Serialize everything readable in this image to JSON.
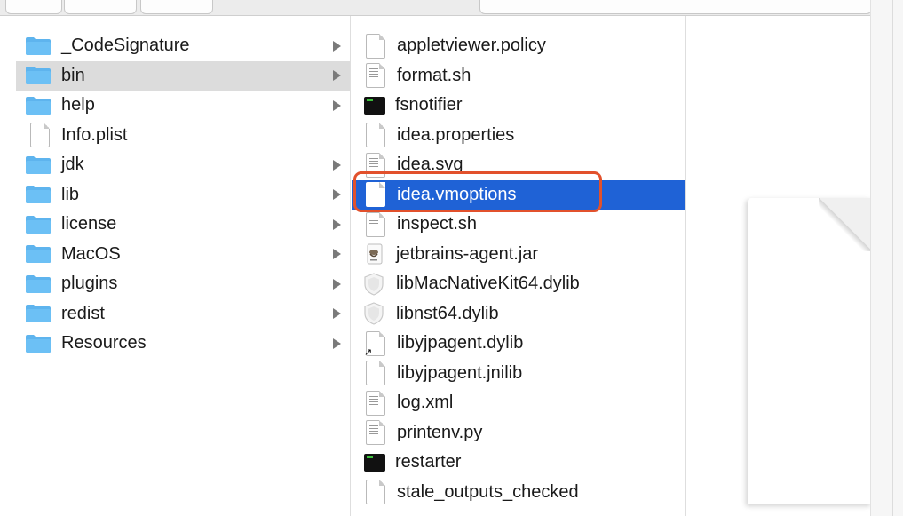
{
  "left_column": {
    "items": [
      {
        "label": "_CodeSignature",
        "kind": "folder",
        "expandable": true
      },
      {
        "label": "bin",
        "kind": "folder",
        "expandable": true,
        "selected": "gray"
      },
      {
        "label": "help",
        "kind": "folder",
        "expandable": true
      },
      {
        "label": "Info.plist",
        "kind": "document",
        "expandable": false
      },
      {
        "label": "jdk",
        "kind": "folder",
        "expandable": true
      },
      {
        "label": "lib",
        "kind": "folder",
        "expandable": true
      },
      {
        "label": "license",
        "kind": "folder",
        "expandable": true
      },
      {
        "label": "MacOS",
        "kind": "folder",
        "expandable": true
      },
      {
        "label": "plugins",
        "kind": "folder",
        "expandable": true
      },
      {
        "label": "redist",
        "kind": "folder",
        "expandable": true
      },
      {
        "label": "Resources",
        "kind": "folder",
        "expandable": true
      }
    ]
  },
  "bin_column": {
    "items": [
      {
        "label": "appletviewer.policy",
        "kind": "document"
      },
      {
        "label": "format.sh",
        "kind": "text-document"
      },
      {
        "label": "fsnotifier",
        "kind": "terminal-executable"
      },
      {
        "label": "idea.properties",
        "kind": "document"
      },
      {
        "label": "idea.svg",
        "kind": "text-document"
      },
      {
        "label": "idea.vmoptions",
        "kind": "document",
        "selected": "blue"
      },
      {
        "label": "inspect.sh",
        "kind": "text-document"
      },
      {
        "label": "jetbrains-agent.jar",
        "kind": "jar-archive"
      },
      {
        "label": "libMacNativeKit64.dylib",
        "kind": "shield-library"
      },
      {
        "label": "libnst64.dylib",
        "kind": "shield-library"
      },
      {
        "label": "libyjpagent.dylib",
        "kind": "alias-document"
      },
      {
        "label": "libyjpagent.jnilib",
        "kind": "document"
      },
      {
        "label": "log.xml",
        "kind": "text-document"
      },
      {
        "label": "printenv.py",
        "kind": "text-document"
      },
      {
        "label": "restarter",
        "kind": "terminal-executable"
      },
      {
        "label": "stale_outputs_checked",
        "kind": "document"
      }
    ]
  },
  "colors": {
    "selection_blue": "#1f62d6",
    "selection_gray": "#dcdcdc",
    "folder_blue": "#5eb4ee",
    "highlight_annotation": "#e2512c"
  }
}
